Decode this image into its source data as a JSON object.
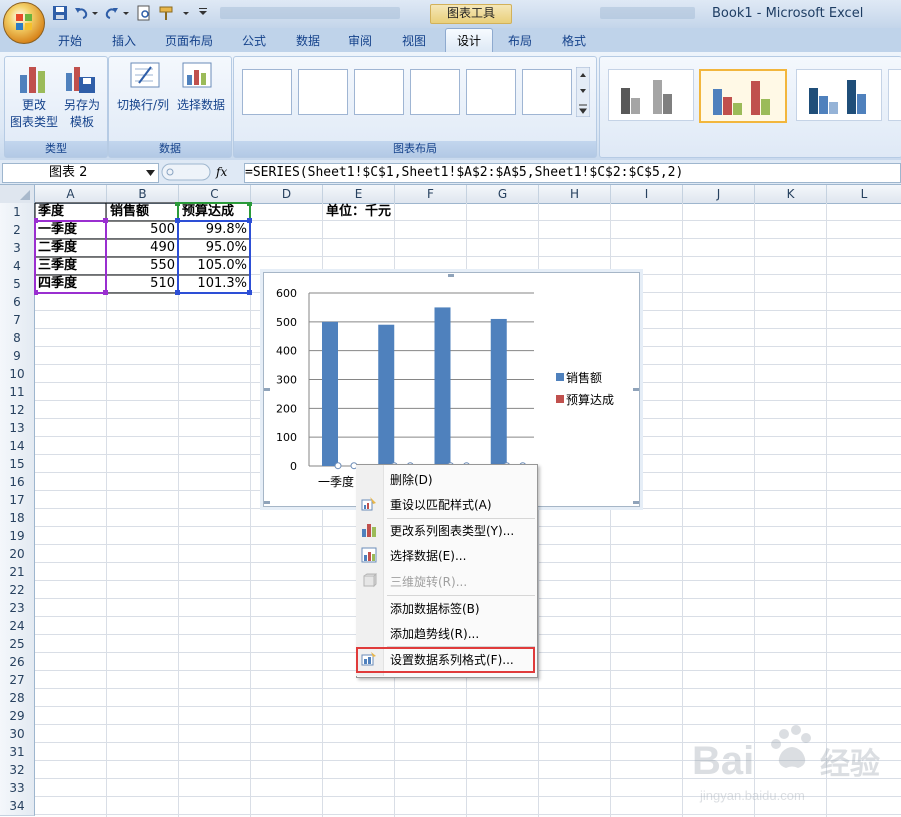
{
  "window": {
    "tool_title": "图表工具",
    "title": "Book1 - Microsoft Excel"
  },
  "tabs": [
    "开始",
    "插入",
    "页面布局",
    "公式",
    "数据",
    "审阅",
    "视图",
    "设计",
    "布局",
    "格式"
  ],
  "active_tab_index": 7,
  "ribbon": {
    "group_type": {
      "label": "类型",
      "btn1_line1": "更改",
      "btn1_line2": "图表类型",
      "btn2_line1": "另存为",
      "btn2_line2": "模板"
    },
    "group_data": {
      "label": "数据",
      "btn1": "切换行/列",
      "btn2": "选择数据"
    },
    "group_layout": {
      "label": "图表布局"
    }
  },
  "formula_bar": {
    "name_box": "图表 2",
    "fx": "fx",
    "formula": "=SERIES(Sheet1!$C$1,Sheet1!$A$2:$A$5,Sheet1!$C$2:$C$5,2)"
  },
  "columns": [
    "A",
    "B",
    "C",
    "D",
    "E",
    "F",
    "G",
    "H",
    "I",
    "J",
    "K",
    "L"
  ],
  "rows": [
    "1",
    "2",
    "3",
    "4",
    "5",
    "6",
    "7",
    "8",
    "9",
    "10",
    "11",
    "12",
    "13",
    "14",
    "15",
    "16",
    "17",
    "18",
    "19",
    "20",
    "21",
    "22",
    "23",
    "24",
    "25",
    "26",
    "27",
    "28",
    "29",
    "30",
    "31",
    "32",
    "33",
    "34"
  ],
  "table": {
    "headers": [
      "季度",
      "销售额",
      "预算达成"
    ],
    "rows": [
      [
        "一季度",
        "500",
        "99.8%"
      ],
      [
        "二季度",
        "490",
        "95.0%"
      ],
      [
        "三季度",
        "550",
        "105.0%"
      ],
      [
        "四季度",
        "510",
        "101.3%"
      ]
    ],
    "unit_note": "单位：千元"
  },
  "chart_data": {
    "type": "bar",
    "categories": [
      "一季度",
      "二季度",
      "三季度",
      "四季度"
    ],
    "visible_category_label": "一季度",
    "series": [
      {
        "name": "销售额",
        "values": [
          500,
          490,
          550,
          510
        ],
        "color": "#4f81bd"
      },
      {
        "name": "预算达成",
        "values": [
          0.998,
          0.95,
          1.05,
          1.013
        ],
        "color": "#c0504d"
      }
    ],
    "ylim": [
      0,
      600
    ],
    "yticks": [
      "0",
      "100",
      "200",
      "300",
      "400",
      "500",
      "600"
    ],
    "grid": true,
    "legend": "right"
  },
  "context_menu": {
    "items": [
      {
        "label": "删除(D)",
        "disabled": false
      },
      {
        "label": "重设以匹配样式(A)",
        "disabled": false
      },
      {
        "label": "更改系列图表类型(Y)...",
        "disabled": false
      },
      {
        "label": "选择数据(E)...",
        "disabled": false
      },
      {
        "label": "三维旋转(R)...",
        "disabled": true
      },
      {
        "label": "添加数据标签(B)",
        "disabled": false
      },
      {
        "label": "添加趋势线(R)...",
        "disabled": false
      },
      {
        "label": "设置数据系列格式(F)...",
        "disabled": false
      }
    ],
    "highlighted_index": 7
  },
  "colors": {
    "accent": "#4f81bd",
    "secondary": "#c0504d",
    "highlight_box": "#e03b3b"
  }
}
